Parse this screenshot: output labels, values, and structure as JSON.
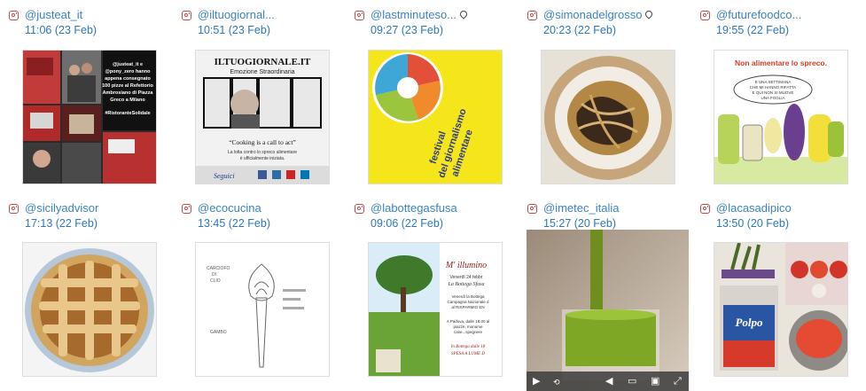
{
  "posts": [
    {
      "user": "@justeat_it",
      "time": "11:06 (23 Feb)",
      "location": false,
      "image": "justeat-collage",
      "overlay": [
        "@justeat_it e",
        "@pony_zero hanno",
        "appena consegnato",
        "100 pizze al Refettorio",
        "Ambrosiano di Piazza",
        "Greco a Milano",
        "#RistoranteSolidale"
      ]
    },
    {
      "user": "@iltuogiornal...",
      "time": "10:51 (23 Feb)",
      "location": false,
      "image": "ciao-poster",
      "overlay": [
        "ILTUOGIORNALE.IT",
        "Emozione Straordinaria",
        "“Cooking is a call to act”",
        "La lotta contro lo spreco alimentare",
        "è ufficialmente iniziata.",
        "Seguici"
      ]
    },
    {
      "user": "@lastminuteso...",
      "time": "09:27 (23 Feb)",
      "location": true,
      "image": "festival-giornalismo",
      "overlay": [
        "festival",
        "del giornalismo",
        "alimentare"
      ]
    },
    {
      "user": "@simonadelgrosso",
      "time": "20:23 (22 Feb)",
      "location": true,
      "image": "pasta-plate",
      "overlay": []
    },
    {
      "user": "@futurefoodco...",
      "time": "19:55 (22 Feb)",
      "location": false,
      "image": "spreco-cartoon",
      "overlay": [
        "Non alimentare lo spreco.",
        "È UNA SETTIMANA",
        "CHE MI HANNO RIFATTA",
        "E QUI NON SI MUOVE",
        "UNA FOGLIA"
      ]
    },
    {
      "user": "@sicilyadvisor",
      "time": "17:13 (22 Feb)",
      "location": false,
      "image": "crostata",
      "overlay": []
    },
    {
      "user": "@ecocucina",
      "time": "13:45 (22 Feb)",
      "location": false,
      "image": "artichoke-sketch",
      "overlay": [
        "CARCIOFO",
        "DI",
        "CLIO",
        "GAMBO"
      ]
    },
    {
      "user": "@labottegasfusa",
      "time": "09:06 (22 Feb)",
      "location": false,
      "image": "m-illumino",
      "overlay": [
        "M' illumino",
        "Venerdì 24 febbr",
        "La Bottega Sfusa",
        "Venerdì la Bottega",
        "Campagna Nazionale d",
        "al RISPARMIO EN",
        "A Padova, dalle 18.00 al",
        "piazze, monume",
        "case...spegnere",
        "In Bottega dalle 18",
        "SPESA A LUME D"
      ]
    },
    {
      "user": "@imetec_italia",
      "time": "15:27 (20 Feb)",
      "location": false,
      "image": "green-juice-video",
      "overlay": []
    },
    {
      "user": "@lacasadipico",
      "time": "13:50 (20 Feb)",
      "location": false,
      "image": "polpo-tomatoes",
      "overlay": [
        "Polpo"
      ]
    }
  ]
}
